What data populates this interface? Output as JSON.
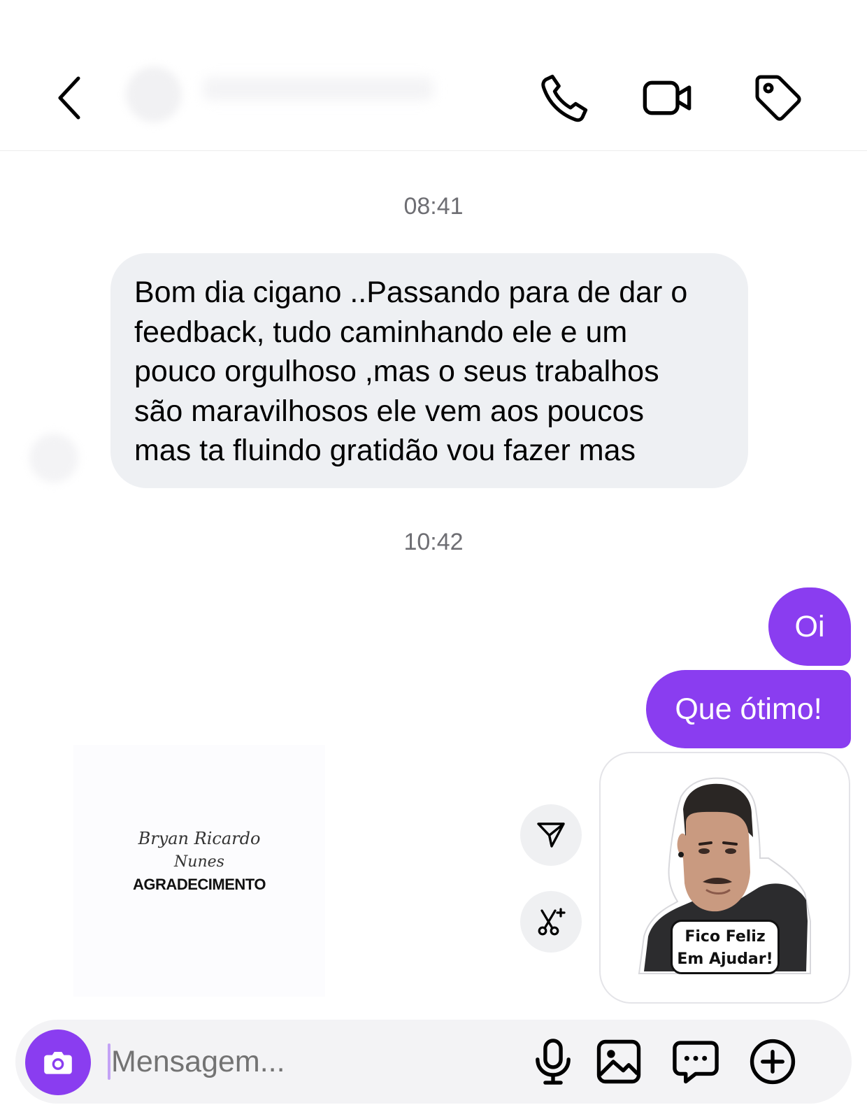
{
  "header": {
    "back_icon": "chevron-left-icon",
    "actions": [
      {
        "name": "phone-icon"
      },
      {
        "name": "video-camera-icon"
      },
      {
        "name": "tag-icon"
      }
    ]
  },
  "messages": {
    "timestamp_1": "08:41",
    "incoming_lines": [
      "Bom dia cigano ..Passando para de dar o",
      "feedback, tudo caminhando ele e um",
      "pouco orgulhoso ,mas o seus trabalhos",
      "são maravilhosos ele vem aos poucos",
      "mas ta fluindo gratidão vou fazer mas"
    ],
    "timestamp_2": "10:42",
    "outgoing_1": "Oi",
    "outgoing_2": "Que ótimo!"
  },
  "card": {
    "signature_line1": "Bryan Ricardo",
    "signature_line2": "Nunes",
    "title": "AGRADECIMENTO"
  },
  "side_actions": [
    {
      "name": "send-icon"
    },
    {
      "name": "magic-edit-icon"
    }
  ],
  "sticker": {
    "line1": "Fico Feliz",
    "line2": "Em Ajudar!"
  },
  "composer": {
    "placeholder": "Mensagem...",
    "value": "",
    "icons": [
      "microphone-icon",
      "image-icon",
      "chat-bubble-icon",
      "plus-circle-icon"
    ]
  },
  "colors": {
    "accent": "#8a3df0",
    "incoming_bubble": "#eef0f3",
    "timestamp": "#6e6e73"
  }
}
